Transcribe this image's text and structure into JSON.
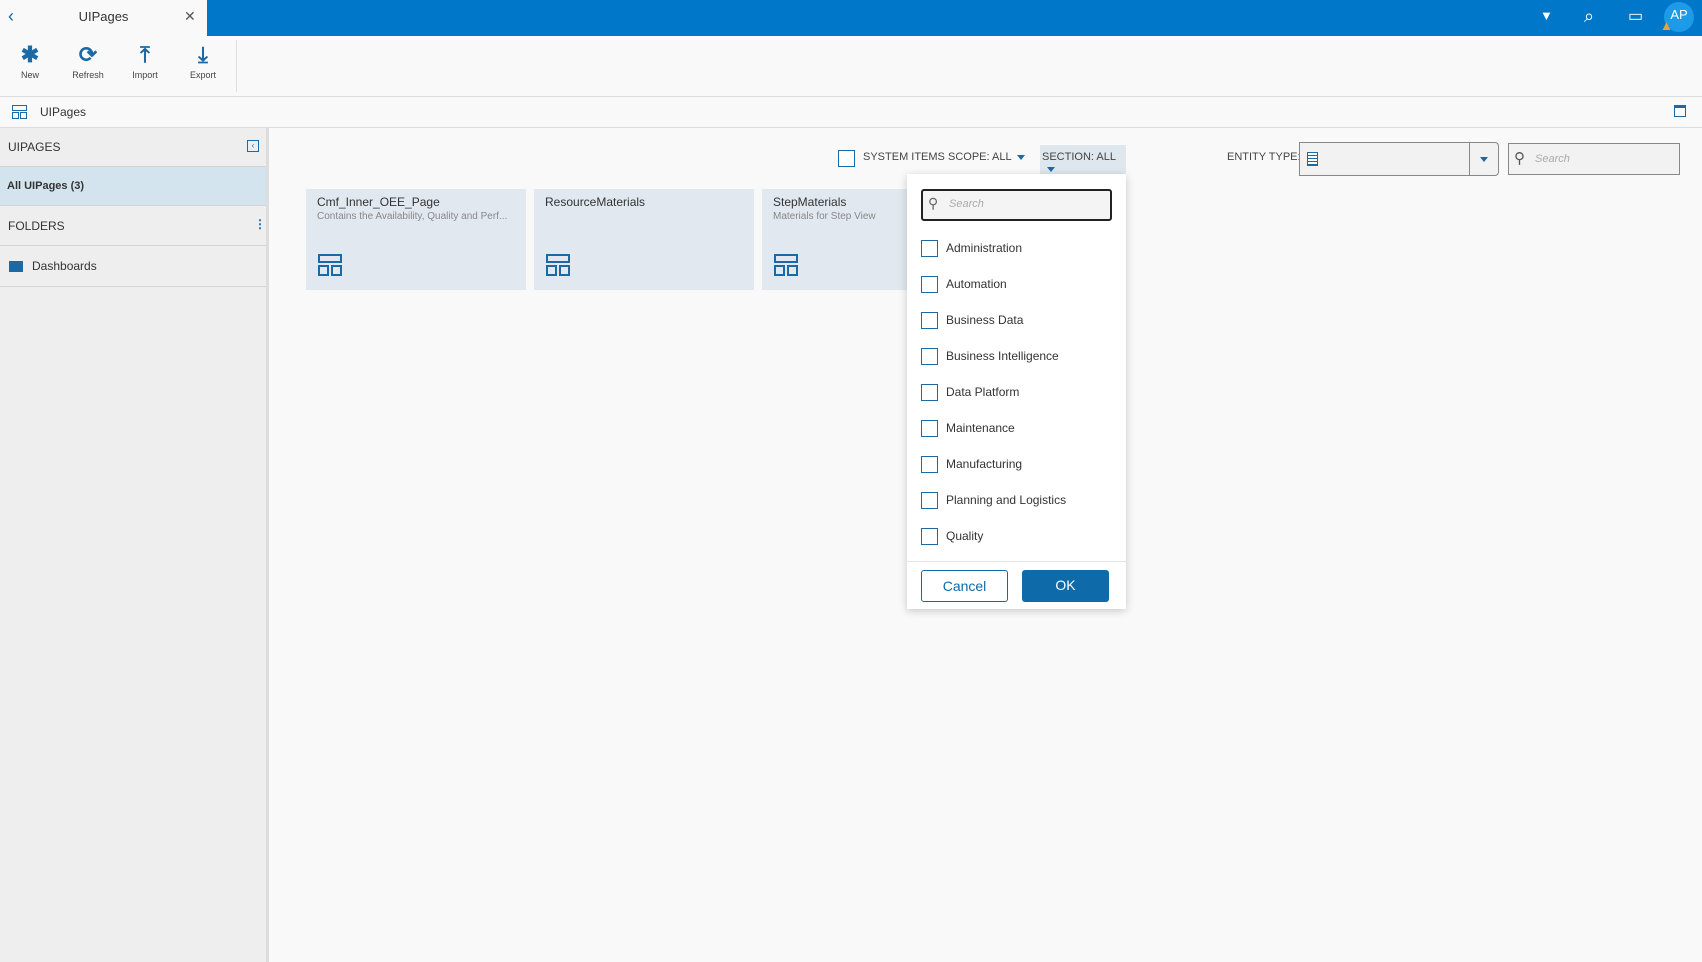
{
  "tab": {
    "title": "UIPages"
  },
  "user": {
    "initials": "AP"
  },
  "toolbar": {
    "new": "New",
    "refresh": "Refresh",
    "import": "Import",
    "export": "Export"
  },
  "breadcrumb": {
    "title": "UIPages"
  },
  "sidebar": {
    "header": "UIPAGES",
    "all": "All UIPages (3)",
    "folders": "FOLDERS",
    "folder_items": [
      "Dashboards"
    ]
  },
  "filters": {
    "system_items": "SYSTEM ITEMS",
    "scope": "SCOPE: ALL",
    "section": "SECTION: ALL",
    "entity_type": "ENTITY TYPE:",
    "search_placeholder": "Search"
  },
  "cards": [
    {
      "name": "Cmf_Inner_OEE_Page",
      "desc": "Contains the Availability, Quality and Perf..."
    },
    {
      "name": "ResourceMaterials",
      "desc": ""
    },
    {
      "name": "StepMaterials",
      "desc": "Materials for Step View"
    }
  ],
  "section_dropdown": {
    "search_placeholder": "Search",
    "options": [
      "Administration",
      "Automation",
      "Business Data",
      "Business Intelligence",
      "Data Platform",
      "Maintenance",
      "Manufacturing",
      "Planning and Logistics",
      "Quality"
    ],
    "cancel": "Cancel",
    "ok": "OK"
  },
  "colors": {
    "accent": "#0077c8",
    "button": "#0e6aa8"
  }
}
